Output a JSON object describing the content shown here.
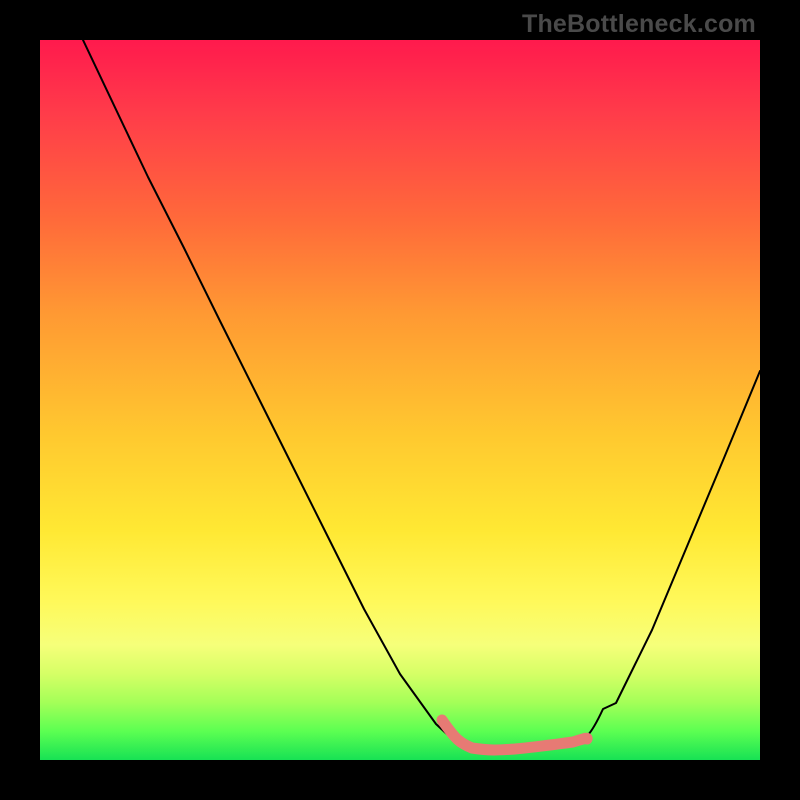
{
  "brand": "TheBottleneck.com",
  "chart_data": {
    "type": "line",
    "title": "",
    "xlabel": "",
    "ylabel": "",
    "xlim": [
      0,
      100
    ],
    "ylim": [
      0,
      100
    ],
    "grid": false,
    "legend": false,
    "series": [
      {
        "name": "bottleneck-curve",
        "x": [
          6,
          10,
          15,
          20,
          25,
          30,
          35,
          40,
          45,
          50,
          55,
          58,
          60,
          63,
          66,
          70,
          74,
          76,
          80,
          85,
          90,
          95,
          100
        ],
        "y": [
          100,
          91,
          81,
          71,
          61,
          51,
          41,
          31,
          21,
          12,
          5,
          2.2,
          1.6,
          1.3,
          1.4,
          1.7,
          2.3,
          3.2,
          8,
          18,
          30,
          42,
          54
        ]
      }
    ],
    "highlight": {
      "name": "optimum-range",
      "x_range": [
        55.8,
        76
      ],
      "y_approx": 2
    },
    "background_gradient": [
      "#ff1a4d",
      "#ff6a3a",
      "#ffc92f",
      "#fff95a",
      "#5cff52",
      "#17e254"
    ]
  }
}
